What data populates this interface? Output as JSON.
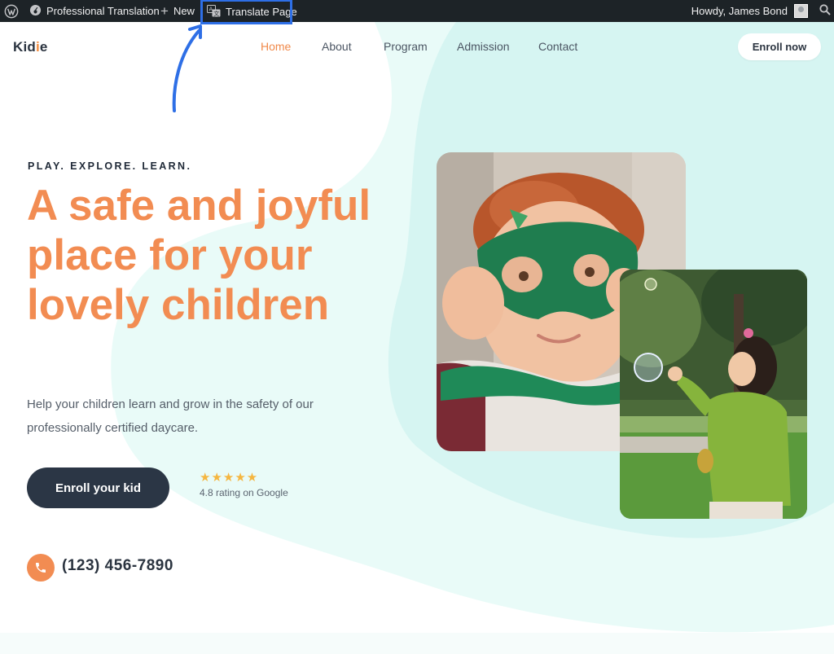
{
  "adminbar": {
    "site_name": "Professional Translation",
    "new_label": "New",
    "translate_label": "Translate Page",
    "greeting": "Howdy, James Bond"
  },
  "header": {
    "logo": {
      "pre": "Kid",
      "accent": "i",
      "post": "e"
    },
    "nav": [
      "Home",
      "About",
      "Program",
      "Admission",
      "Contact"
    ],
    "active_nav": "Home",
    "enroll_now": "Enroll now"
  },
  "hero": {
    "eyebrow": "PLAY. EXPLORE. LEARN.",
    "headline": "A safe and joyful place for your lovely children",
    "subtext": "Help your children learn and grow in the safety of our professionally certified daycare.",
    "cta": "Enroll your kid",
    "stars": "★★★★★",
    "rating_value": 4.8,
    "rating_text": "4.8 rating on Google",
    "phone": "(123) 456-7890"
  },
  "colors": {
    "adminbar_bg": "#1d2327",
    "highlight": "#2e6fe6",
    "accent_orange": "#f28c52",
    "dark_button": "#2b3645",
    "blob": "#d6f5f2",
    "star": "#f5b640"
  },
  "icons": {
    "wordpress": "wordpress-logo-icon",
    "dashboard": "palette-icon",
    "plus": "plus-icon",
    "translate": "translate-icon",
    "search": "search-icon",
    "phone": "phone-icon"
  }
}
